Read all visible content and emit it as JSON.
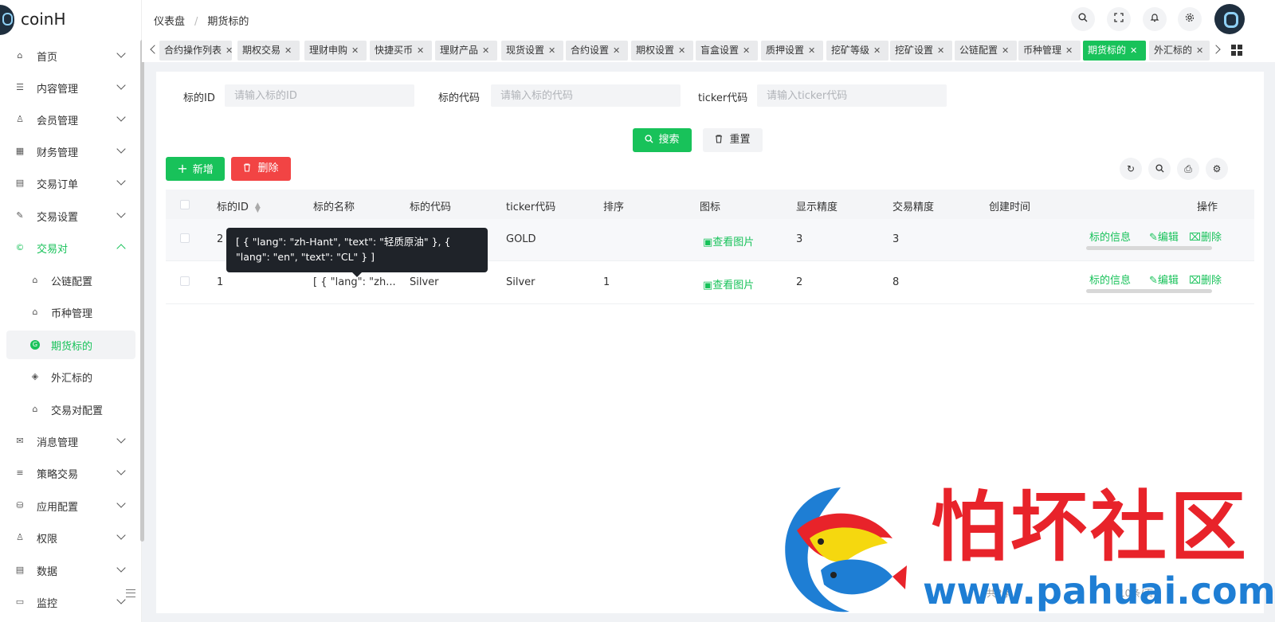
{
  "app": {
    "logo_text": "coinH"
  },
  "sidebar": {
    "items": [
      {
        "label": "首页",
        "icon": "home-icon"
      },
      {
        "label": "内容管理",
        "icon": "list-icon"
      },
      {
        "label": "会员管理",
        "icon": "user-icon"
      },
      {
        "label": "财务管理",
        "icon": "finance-icon"
      },
      {
        "label": "交易订单",
        "icon": "order-icon"
      },
      {
        "label": "交易设置",
        "icon": "wrench-icon"
      },
      {
        "label": "交易对",
        "icon": "copyright-icon",
        "expanded": true
      },
      {
        "label": "消息管理",
        "icon": "mail-icon"
      },
      {
        "label": "策略交易",
        "icon": "menu-icon"
      },
      {
        "label": "应用配置",
        "icon": "database-icon"
      },
      {
        "label": "权限",
        "icon": "user-lock-icon"
      },
      {
        "label": "数据",
        "icon": "data-icon"
      },
      {
        "label": "监控",
        "icon": "monitor-icon"
      }
    ],
    "sub_items": [
      {
        "label": "公链配置",
        "icon": "home-icon"
      },
      {
        "label": "币种管理",
        "icon": "home-icon"
      },
      {
        "label": "期货标的",
        "icon": "g-icon",
        "active": true
      },
      {
        "label": "外汇标的",
        "icon": "tag-icon"
      },
      {
        "label": "交易对配置",
        "icon": "home-icon"
      }
    ]
  },
  "header": {
    "breadcrumb": [
      "仪表盘",
      "期货标的"
    ],
    "sep": "/"
  },
  "tabs": [
    {
      "label": "合约操作列表"
    },
    {
      "label": "期权交易"
    },
    {
      "label": "理财申购"
    },
    {
      "label": "快捷买币"
    },
    {
      "label": "理财产品"
    },
    {
      "label": "现货设置"
    },
    {
      "label": "合约设置"
    },
    {
      "label": "期权设置"
    },
    {
      "label": "盲盒设置"
    },
    {
      "label": "质押设置"
    },
    {
      "label": "挖矿等级"
    },
    {
      "label": "挖矿设置"
    },
    {
      "label": "公链配置"
    },
    {
      "label": "币种管理"
    },
    {
      "label": "期货标的",
      "active": true
    },
    {
      "label": "外汇标的"
    }
  ],
  "search": {
    "id_label": "标的ID",
    "id_placeholder": "请输入标的ID",
    "code_label": "标的代码",
    "code_placeholder": "请输入标的代码",
    "ticker_label": "ticker代码",
    "ticker_placeholder": "请输入ticker代码",
    "search_btn": "搜索",
    "reset_btn": "重置"
  },
  "toolbar": {
    "add_btn": "新增",
    "delete_btn": "删除"
  },
  "table": {
    "headers": [
      "标的ID",
      "标的名称",
      "标的代码",
      "ticker代码",
      "排序",
      "图标",
      "显示精度",
      "交易精度",
      "创建时间",
      "操作"
    ],
    "rows": [
      {
        "id": "2",
        "name": "",
        "code": "",
        "ticker": "GOLD",
        "sort": "",
        "icon": "查看图片",
        "display_precision": "3",
        "trade_precision": "3",
        "created": ""
      },
      {
        "id": "1",
        "name": "[ { \"lang\": \"zh...",
        "code": "Silver",
        "ticker": "Silver",
        "sort": "1",
        "icon": "查看图片",
        "display_precision": "2",
        "trade_precision": "8",
        "created": ""
      }
    ],
    "actions": {
      "info": "标的信息",
      "edit": "编辑",
      "delete": "删除"
    }
  },
  "tooltip": {
    "text": "[ { \"lang\": \"zh-Hant\", \"text\": \"轻质原油\" }, { \"lang\": \"en\", \"text\": \"CL\" } ]"
  },
  "pagination": {
    "total_text": "共2条",
    "page_size": "10条/页"
  },
  "watermark": {
    "title": "怕坏社区",
    "url": "www.pahuai.com"
  },
  "colors": {
    "accent": "#18c25a",
    "danger": "#f24444",
    "watermark_red": "#e8232a",
    "watermark_blue": "#1e7ed4"
  }
}
